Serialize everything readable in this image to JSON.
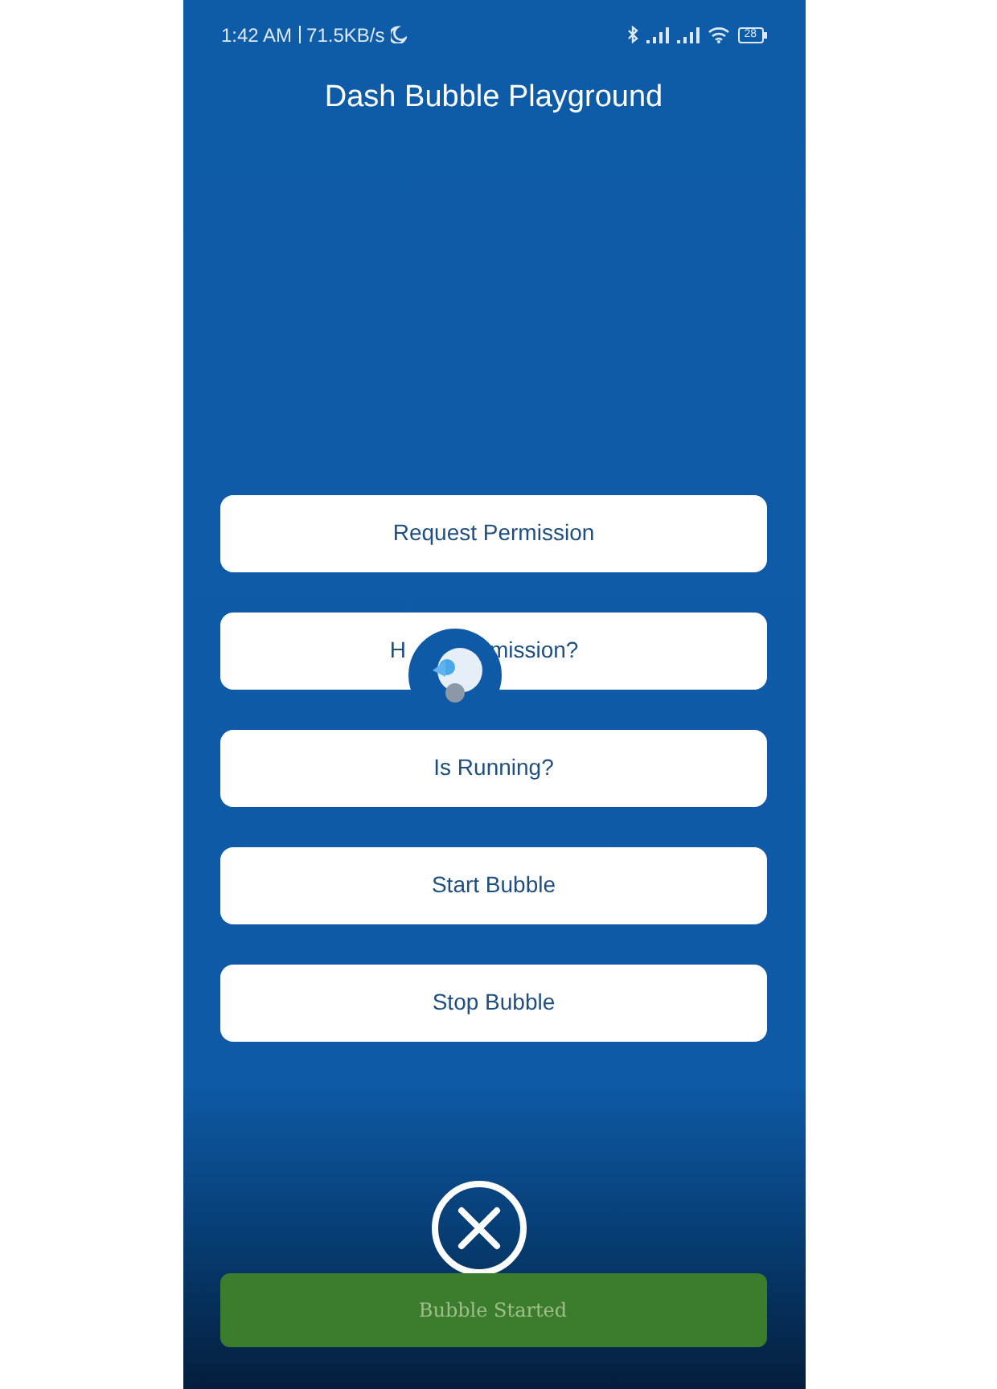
{
  "status_bar": {
    "time": "1:42 AM",
    "speed": "71.5KB/s",
    "battery": "28"
  },
  "app_bar": {
    "title": "Dash Bubble Playground"
  },
  "buttons": [
    {
      "kind": "plain",
      "label": "Request Permission"
    },
    {
      "kind": "covered",
      "label_before": "H",
      "label_after": "mission?"
    },
    {
      "kind": "plain",
      "label": "Is Running?"
    },
    {
      "kind": "plain",
      "label": "Start Bubble"
    },
    {
      "kind": "plain",
      "label": "Stop Bubble"
    }
  ],
  "snackbar": {
    "message": "Bubble Started"
  }
}
